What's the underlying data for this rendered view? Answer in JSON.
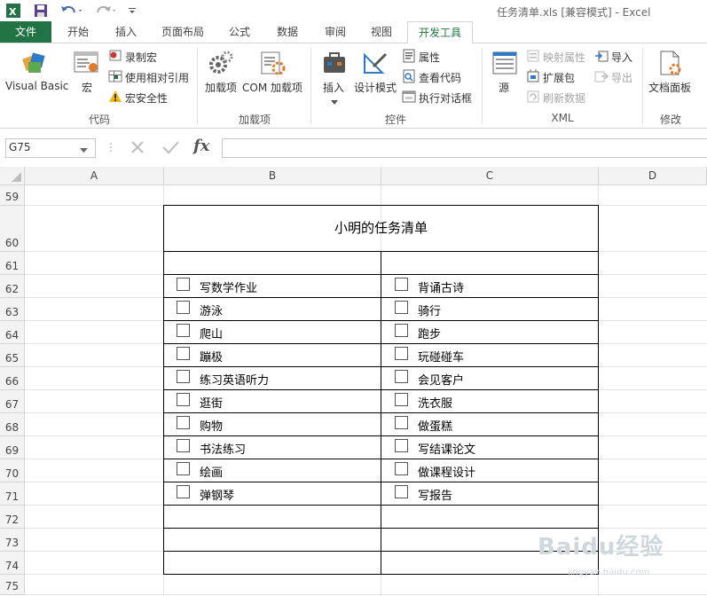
{
  "window": {
    "title": "任务清单.xls  [兼容模式] - Excel"
  },
  "tabs": [
    "文件",
    "开始",
    "插入",
    "页面布局",
    "公式",
    "数据",
    "审阅",
    "视图",
    "开发工具"
  ],
  "ribbon": {
    "code": {
      "group_label": "代码",
      "visual_basic": "Visual Basic",
      "macros": "宏",
      "record_macro": "录制宏",
      "relative_ref": "使用相对引用",
      "macro_security": "宏安全性"
    },
    "addins": {
      "group_label": "加载项",
      "addins": "加载项",
      "com_addins": "COM 加载项"
    },
    "controls": {
      "group_label": "控件",
      "insert": "插入",
      "design_mode": "设计模式",
      "properties": "属性",
      "view_code": "查看代码",
      "run_dialog": "执行对话框"
    },
    "xml": {
      "group_label": "XML",
      "source": "源",
      "map_properties": "映射属性",
      "expansion_packs": "扩展包",
      "refresh_data": "刷新数据",
      "import": "导入",
      "export": "导出"
    },
    "modify": {
      "group_label": "修改",
      "document_panel": "文档面板"
    }
  },
  "formula_bar": {
    "name_box": "G75",
    "fx_label": "fx",
    "value": ""
  },
  "grid": {
    "columns": [
      "A",
      "B",
      "C",
      "D"
    ],
    "rows": [
      "59",
      "60",
      "61",
      "62",
      "63",
      "64",
      "65",
      "66",
      "67",
      "68",
      "69",
      "70",
      "71",
      "72",
      "73",
      "74",
      "75"
    ]
  },
  "checklist": {
    "title": "小明的任务清单",
    "left": [
      "写数学作业",
      "游泳",
      "爬山",
      "蹦极",
      "练习英语听力",
      "逛街",
      "购物",
      "书法练习",
      "绘画",
      "弹钢琴"
    ],
    "right": [
      "背诵古诗",
      "骑行",
      "跑步",
      "玩碰碰车",
      "会见客户",
      "洗衣服",
      "做蛋糕",
      "写结课论文",
      "做课程设计",
      "写报告"
    ]
  },
  "watermark": {
    "text": "Baidu经验",
    "sub": "jingyan.baidu.com"
  },
  "colors": {
    "excel_green": "#217346",
    "header_bg": "#f3f3f3",
    "gridline": "#e3e3e3"
  }
}
